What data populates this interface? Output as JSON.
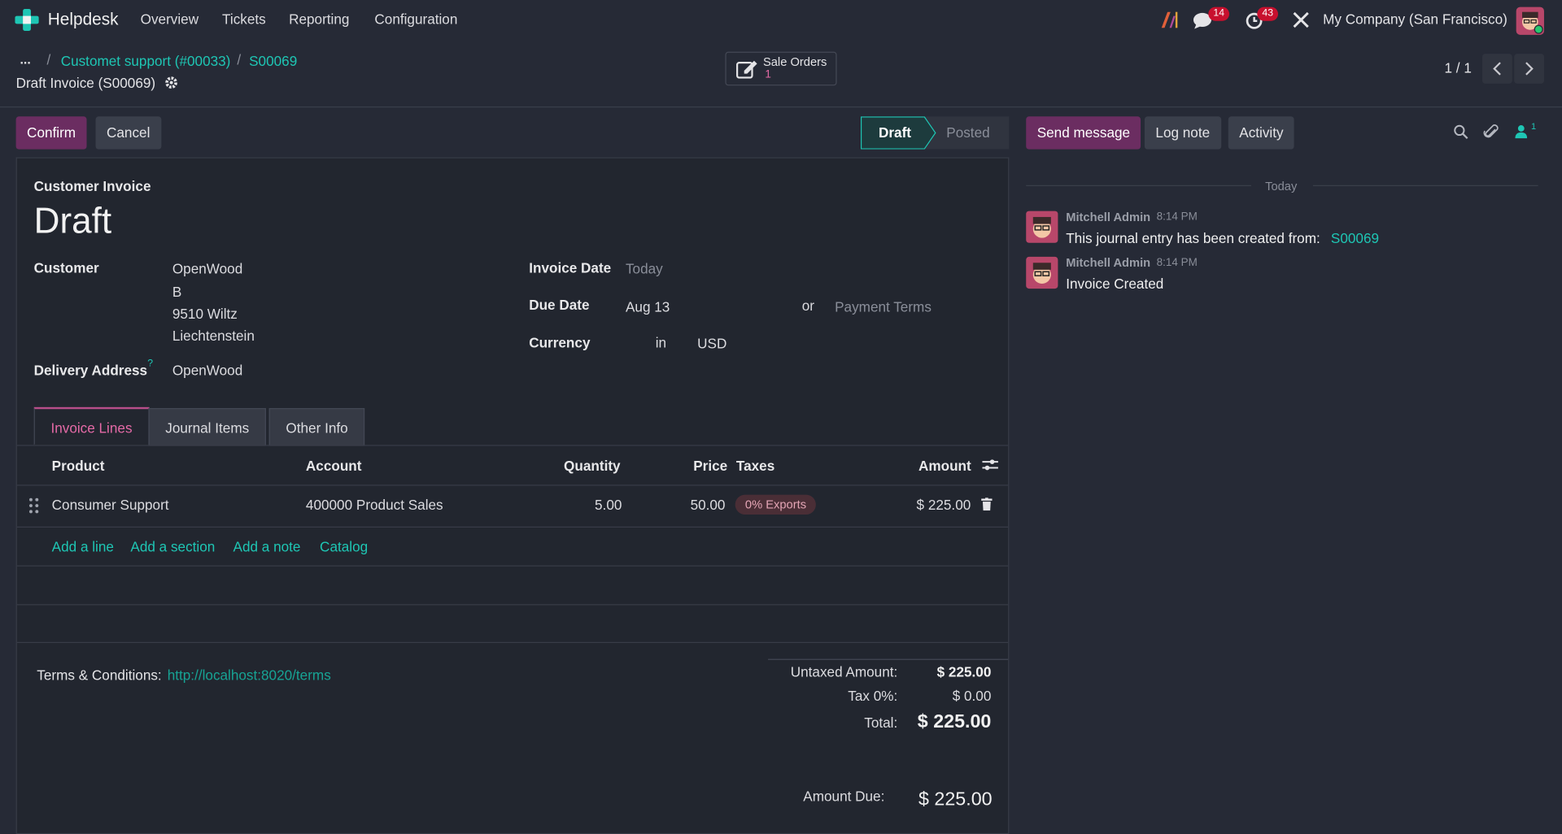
{
  "navbar": {
    "app_name": "Helpdesk",
    "menu": [
      "Overview",
      "Tickets",
      "Reporting",
      "Configuration"
    ],
    "messages_count": "14",
    "activities_count": "43",
    "company": "My Company (San Francisco)",
    "icons": [
      "app-logo",
      "ai-icon",
      "chat-icon",
      "clock-icon",
      "tools-icon",
      "avatar"
    ]
  },
  "breadcrumb": {
    "ellipsis": "...",
    "items": [
      "Customet support (#00033)",
      "S00069"
    ],
    "current": "Draft Invoice (S00069)"
  },
  "smart_button": {
    "label": "Sale Orders",
    "count": "1"
  },
  "pager": {
    "value": "1 / 1"
  },
  "actions": {
    "confirm": "Confirm",
    "cancel": "Cancel"
  },
  "status": {
    "stages": [
      "Draft",
      "Posted"
    ],
    "active": "Draft"
  },
  "invoice": {
    "type": "Customer Invoice",
    "name": "Draft",
    "customer_label": "Customer",
    "customer_lines": [
      "OpenWood",
      "B",
      "9510 Wiltz",
      "Liechtenstein"
    ],
    "delivery_label": "Delivery Address",
    "delivery_help": "?",
    "delivery_value": "OpenWood",
    "invoice_date_label": "Invoice Date",
    "invoice_date_placeholder": "Today",
    "due_date_label": "Due Date",
    "due_date_value": "Aug 13",
    "or": "or",
    "payment_terms_placeholder": "Payment Terms",
    "currency_label": "Currency",
    "currency_in": "in",
    "currency_value": "USD"
  },
  "tabs": [
    "Invoice Lines",
    "Journal Items",
    "Other Info"
  ],
  "lines": {
    "headers": {
      "product": "Product",
      "account": "Account",
      "quantity": "Quantity",
      "price": "Price",
      "taxes": "Taxes",
      "amount": "Amount"
    },
    "rows": [
      {
        "product": "Consumer Support",
        "account": "400000 Product Sales",
        "quantity": "5.00",
        "price": "50.00",
        "tax": "0% Exports",
        "amount": "$ 225.00"
      }
    ],
    "add_actions": [
      "Add a line",
      "Add a section",
      "Add a note",
      "Catalog"
    ]
  },
  "terms": {
    "label": "Terms & Conditions:",
    "link": "http://localhost:8020/terms"
  },
  "totals": {
    "untaxed_label": "Untaxed Amount:",
    "untaxed_value": "$ 225.00",
    "tax_label": "Tax 0%:",
    "tax_value": "$ 0.00",
    "total_label": "Total:",
    "total_value": "$ 225.00",
    "due_label": "Amount Due:",
    "due_value": "$ 225.00"
  },
  "chatter": {
    "send_message": "Send message",
    "log_note": "Log note",
    "activity": "Activity",
    "followers_count": "1",
    "date_separator": "Today",
    "messages": [
      {
        "author": "Mitchell Admin",
        "time": "8:14 PM",
        "body": "This journal entry has been created from:",
        "link": "S00069"
      },
      {
        "author": "Mitchell Admin",
        "time": "8:14 PM",
        "body": "Invoice Created"
      }
    ]
  },
  "colors": {
    "background": "#262a36",
    "accent": "#1ec6b4",
    "primary": "#6b2d61",
    "badge": "#c8102e"
  }
}
